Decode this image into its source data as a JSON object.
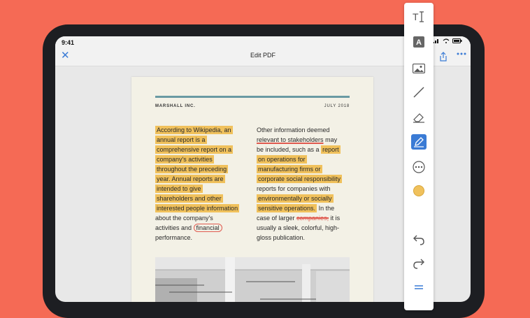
{
  "status_bar": {
    "time": "9:41"
  },
  "nav": {
    "title": "Edit PDF"
  },
  "document": {
    "company": "MARSHALL INC.",
    "date": "JULY 2018",
    "col1": {
      "highlighted": [
        "According to Wikipedia, an",
        "annual report is a",
        "comprehensive report on a",
        "company's activities",
        "throughout the preceding",
        "year. Annual reports are",
        "intended to give",
        "shareholders and other",
        "interested people information"
      ],
      "line_a": "about the company's",
      "line_b_prefix": "activities and",
      "circled_word": "financial",
      "line_c": "performance."
    },
    "col2": {
      "line1": "Other information deemed",
      "underlined": "relevant to stakeholders",
      "line2_suffix": "may",
      "line3_prefix": "be included, such as a",
      "hl1": "report",
      "hl_lines": [
        "on operations for",
        "manufacturing firms or",
        "corporate social responsibility"
      ],
      "line_plain": "reports for companies with",
      "hl_lines2": [
        "environmentally or socially",
        "sensitive operations."
      ],
      "after_hl": "In the",
      "case_prefix": "case of larger",
      "struck": "companies,",
      "case_suffix": "it is",
      "line_end1": "usually a sleek, colorful, high-",
      "line_end2": "gloss publication."
    }
  },
  "toolbar": {
    "tools": [
      "text-cursor-icon",
      "text-box-icon",
      "image-icon",
      "line-icon",
      "eraser-icon",
      "pen-icon",
      "more-icon",
      "color-icon",
      "undo-icon",
      "redo-icon",
      "menu-icon"
    ],
    "selected_tool": "pen-icon",
    "selected_color": "#f0c15c",
    "accent": "#3a7bd5"
  }
}
